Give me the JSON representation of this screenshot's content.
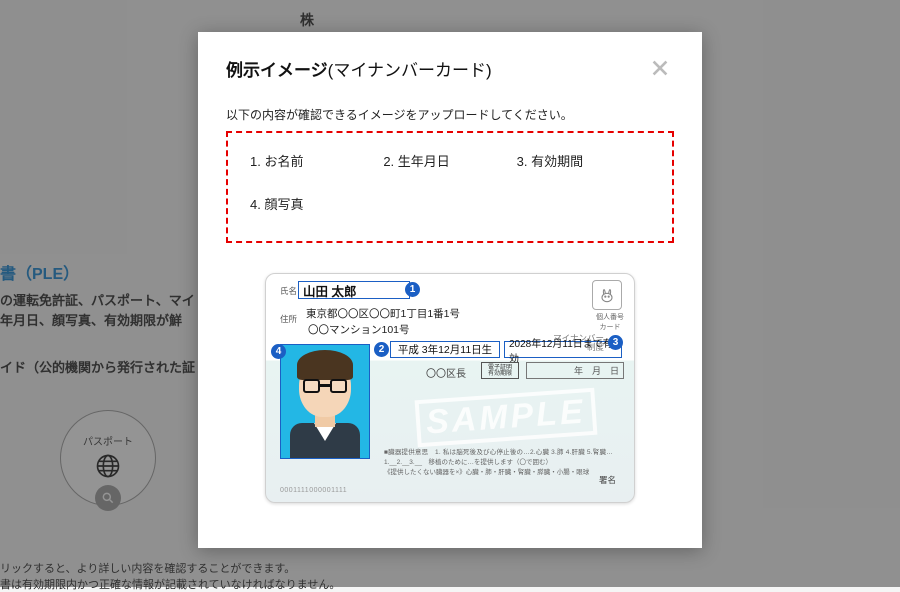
{
  "background": {
    "top_text": "株",
    "ple_heading": "書（PLE）",
    "desc1": "の運転免許証、パスポート、マイ",
    "desc2": "年月日、顔写真、有効期限が鮮",
    "desc3": "イド（公的機関から発行された証",
    "passport_label": "パスポート",
    "bottom1": "リックすると、より詳しい内容を確認することができます。",
    "bottom2": "書は有効期限内かつ正確な情報が記載されていなければなりません。"
  },
  "modal": {
    "title_bold": "例示イメージ",
    "title_paren": "(マイナンバーカード)",
    "instruction": "以下の内容が確認できるイメージをアップロードしてください。",
    "requirements": {
      "r1": "1. お名前",
      "r2": "2. 生年月日",
      "r3": "3. 有効期間",
      "r4": "4. 顔写真"
    }
  },
  "card": {
    "name_label": "氏名",
    "name_value": "山田 太郎",
    "addr_label": "住所",
    "addr_line1": "東京都〇〇区〇〇町1丁目1番1号",
    "addr_line2": "〇〇マンション101号",
    "logo_label": "個人番号\nカード",
    "seido_text": "マイナンバー\n制度",
    "dob_value": "平成 3年12月11日生",
    "exp_value": "2028年12月11日まで有効",
    "district": "〇〇区長",
    "district_box": "電子証明\n有効期限",
    "date_strip": "年　月　日",
    "sample": "SAMPLE",
    "fine1": "■臓器提供意思　1. 私は脳死後及び心停止後の…2.心臓 3.肺 4.肝臓 5.腎臓…",
    "fine2": "1.__2.__3.__　移植のために…を提供します（〇で囲む）",
    "fine3": "《提供したくない臓器を×》心臓・肺・肝臓・腎臓・膵臓・小腸・眼球",
    "signer_label": "署名",
    "barcode": "0001111000001111"
  },
  "badges": {
    "b1": "1",
    "b2": "2",
    "b3": "3",
    "b4": "4"
  }
}
